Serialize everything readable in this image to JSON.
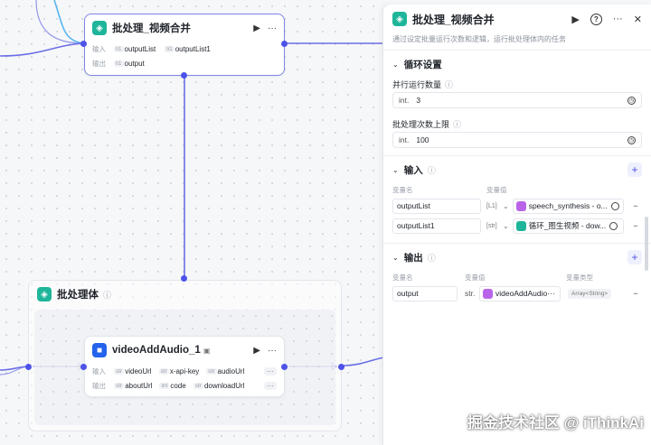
{
  "colors": {
    "accent": "#4d53e8",
    "node_green": "#1fb59a",
    "node_blue": "#2463eb",
    "ref_pink": "#b964e8"
  },
  "merge_node": {
    "title": "批处理_视频合并",
    "icon": "layers-icon",
    "input_label": "输入",
    "output_label": "输出",
    "inputs": [
      {
        "tag": "li1",
        "name": "outputList"
      },
      {
        "tag": "li1",
        "name": "outputList1"
      }
    ],
    "outputs": [
      {
        "tag": "li1",
        "name": "output"
      }
    ]
  },
  "group": {
    "title": "批处理体"
  },
  "video_node": {
    "title": "videoAddAudio_1",
    "icon": "video-icon",
    "input_label": "输入",
    "output_label": "输出",
    "inputs": [
      {
        "tag": "str",
        "name": "videoUrl"
      },
      {
        "tag": "str",
        "name": "x-api-key"
      },
      {
        "tag": "str",
        "name": "audioUrl"
      }
    ],
    "outputs": [
      {
        "tag": "str",
        "name": "aboutUrl"
      },
      {
        "tag": "int",
        "name": "code"
      },
      {
        "tag": "str",
        "name": "downloadUrl"
      }
    ],
    "more_label": "···"
  },
  "panel": {
    "title": "批处理_视频合并",
    "description": "通过设定批量运行次数和逻辑，运行批处理体内的任务",
    "loop_section": "循环设置",
    "parallel_label": "并行运行数量",
    "parallel_type": "int.",
    "parallel_value": "3",
    "max_label": "批处理次数上限",
    "max_type": "int.",
    "max_value": "100",
    "input_section": "输入",
    "input_col_name": "变量名",
    "input_col_value": "变量值",
    "input_rows": [
      {
        "name": "outputList",
        "type": "[L1]",
        "ref": "speech_synthesis - o...",
        "ref_color": "pink"
      },
      {
        "name": "outputList1",
        "type": "[str]",
        "ref": "循环_图生视频 - dow...",
        "ref_color": "teal"
      }
    ],
    "output_section": "输出",
    "output_col_name": "变量名",
    "output_col_value": "变量值",
    "output_col_type": "变量类型",
    "output_rows": [
      {
        "name": "output",
        "type": "str.",
        "ref": "videoAddAudio···",
        "vtype": "Array<String>"
      }
    ]
  },
  "watermark": "掘金技术社区 @ iThinkAi"
}
